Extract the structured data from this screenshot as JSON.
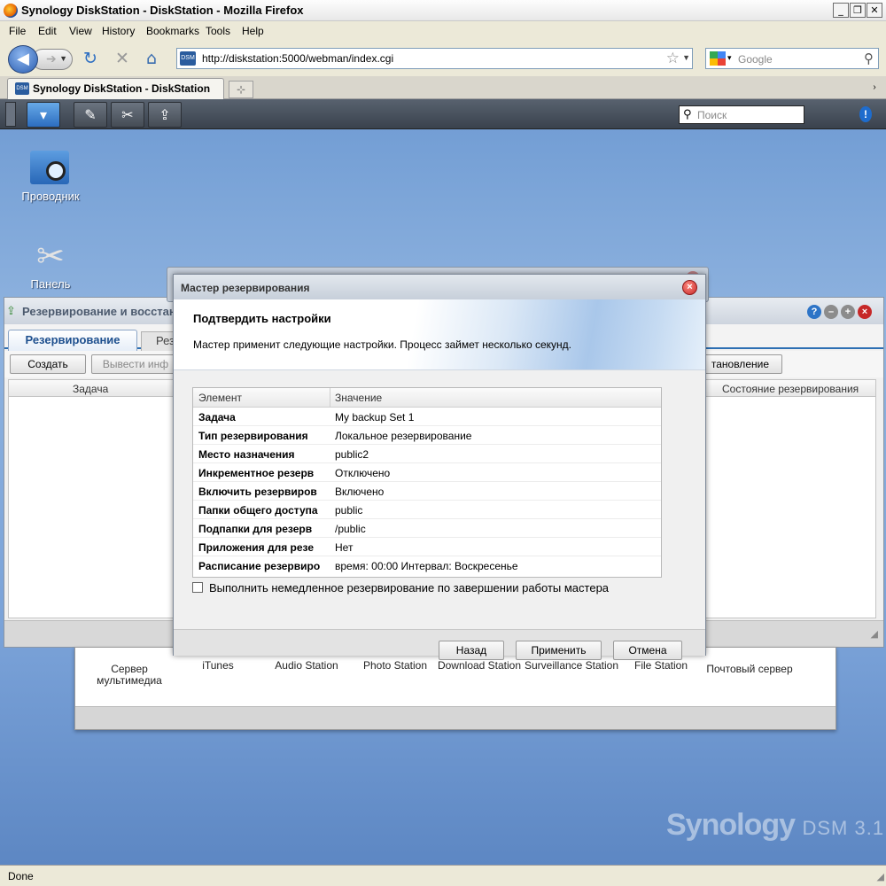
{
  "browser": {
    "title": "Synology DiskStation - DiskStation - Mozilla Firefox",
    "menu": [
      "File",
      "Edit",
      "View",
      "History",
      "Bookmarks",
      "Tools",
      "Help"
    ],
    "url": "http://diskstation:5000/webman/index.cgi",
    "search_placeholder": "Google",
    "tab_title": "Synology DiskStation - DiskStation",
    "status": "Done"
  },
  "dsm": {
    "search_placeholder": "Поиск",
    "desktop_icons": [
      "Проводник",
      "Панель"
    ],
    "brand": "Synology",
    "brand_version": "DSM 3.1"
  },
  "backup_window": {
    "title": "Резервирование и восстан",
    "tabs": [
      "Резервирование",
      "Рез"
    ],
    "buttons": [
      "Создать",
      "Вывести инф",
      "тановление"
    ],
    "columns": [
      "Задача",
      "Состояние резервирования"
    ]
  },
  "main_menu": {
    "items": [
      "Сервер мультимедиа",
      "iTunes",
      "Audio Station",
      "Photo Station",
      "Download Station",
      "Surveillance Station",
      "File Station",
      "Почтовый сервер"
    ]
  },
  "wizard": {
    "title": "Мастер резервирования",
    "heading": "Подтвердить настройки",
    "subtitle": "Мастер применит следующие настройки. Процесс займет несколько секунд.",
    "col_element": "Элемент",
    "col_value": "Значение",
    "rows": [
      {
        "key": "Задача",
        "value": "My backup Set 1"
      },
      {
        "key": "Тип резервирования",
        "value": "Локальное резервирование"
      },
      {
        "key": "Место назначения",
        "value": "public2"
      },
      {
        "key": "Инкрементное резерв",
        "value": "Отключено"
      },
      {
        "key": "Включить резервиров",
        "value": "Включено"
      },
      {
        "key": "Папки общего доступа",
        "value": "public"
      },
      {
        "key": "Подпапки для резерв",
        "value": "/public"
      },
      {
        "key": "Приложения для резе",
        "value": "Нет"
      },
      {
        "key": "Расписание резервиро",
        "value": "время: 00:00 Интервал: Воскресенье"
      }
    ],
    "checkbox_label": "Выполнить немедленное резервирование по завершении работы мастера",
    "checkbox_checked": false,
    "btn_back": "Назад",
    "btn_apply": "Применить",
    "btn_cancel": "Отмена"
  }
}
